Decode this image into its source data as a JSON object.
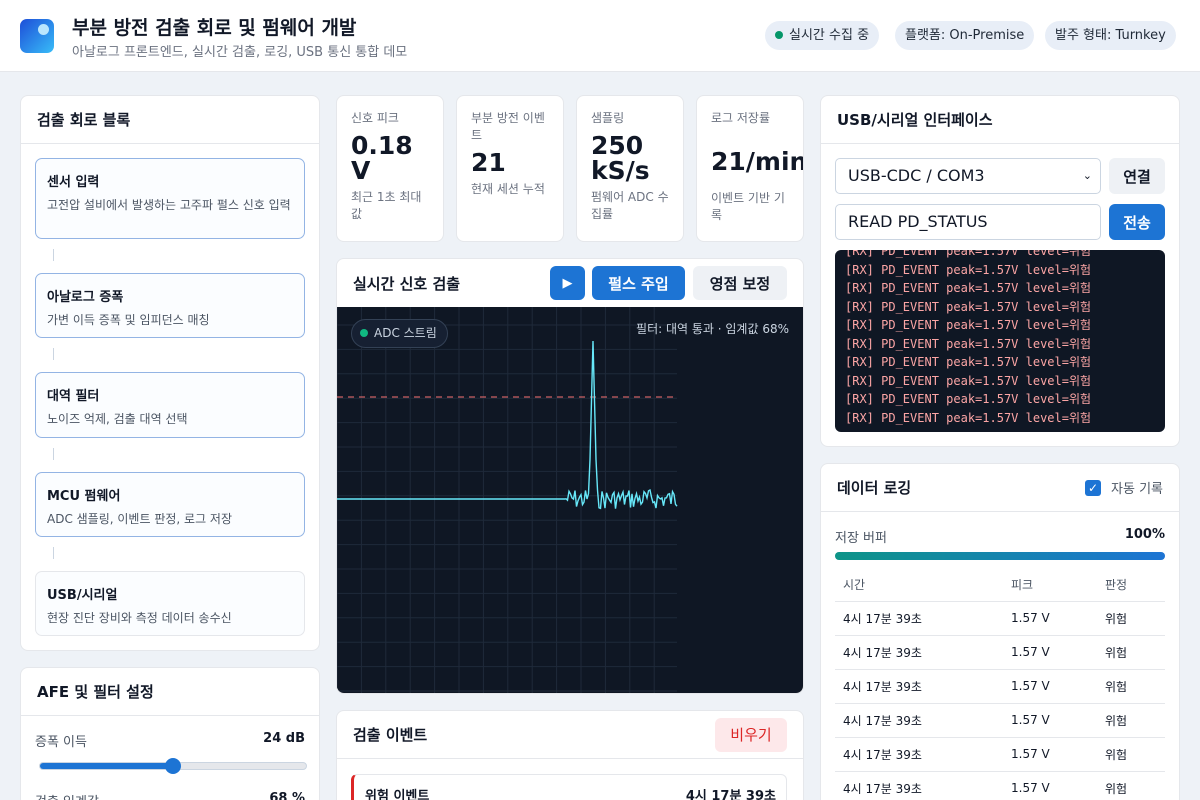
{
  "header": {
    "title": "부분 방전 검출 회로 및 펌웨어 개발",
    "subtitle": "아날로그 프론트엔드, 실시간 검출, 로깅, USB 통신 통합 데모",
    "pills": [
      "실시간 수집 중",
      "플랫폼: On-Premise",
      "발주 형태: Turnkey"
    ]
  },
  "blocks_card": {
    "title": "검출 회로 블록",
    "items": [
      {
        "title": "센서 입력",
        "desc": "고전압 설비에서 발생하는 고주파 펄스 신호 입력"
      },
      {
        "title": "아날로그 증폭",
        "desc": "가변 이득 증폭 및 임피던스 매칭"
      },
      {
        "title": "대역 필터",
        "desc": "노이즈 억제, 검출 대역 선택"
      },
      {
        "title": "MCU 펌웨어",
        "desc": "ADC 샘플링, 이벤트 판정, 로그 저장"
      },
      {
        "title": "USB/시리얼",
        "desc": "현장 진단 장비와 측정 데이터 송수신"
      }
    ]
  },
  "afe_card": {
    "title": "AFE 및 필터 설정",
    "gain_label": "증폭 이득",
    "gain_value": "24 dB",
    "gain_fraction": 0.5,
    "threshold_label": "검출 임계값",
    "threshold_value": "68 %"
  },
  "stats": [
    {
      "label": "신호 피크",
      "value": "0.18 V",
      "sub": "최근 1초 최대값"
    },
    {
      "label": "부분 방전 이벤트",
      "value": "21",
      "sub": "현재 세션 누적"
    },
    {
      "label": "샘플링",
      "value": "250 kS/s",
      "sub": "펌웨어 ADC 수집률"
    },
    {
      "label": "로그 저장률",
      "value": "21/min",
      "sub": "이벤트 기반 기록"
    }
  ],
  "signal_card": {
    "title": "실시간 신호 검출",
    "play_icon": "play-icon",
    "inject_label": "펄스 주입",
    "zero_label": "영점 보정",
    "stream_badge": "ADC 스트림",
    "filter_info": "필터: 대역 통과 · 임계값 68%"
  },
  "events_card": {
    "title": "검출 이벤트",
    "clear_label": "비우기",
    "events": [
      {
        "name": "위험 이벤트",
        "time": "4시 17분 39초"
      }
    ]
  },
  "usb_card": {
    "title": "USB/시리얼 인터페이스",
    "port_selected": "USB-CDC / COM3",
    "connect_label": "연결",
    "command_value": "READ PD_STATUS",
    "send_label": "전송",
    "console_lines": [
      "[RX] PD_EVENT peak=1.57V level=위험",
      "[RX] PD_EVENT peak=1.57V level=위험",
      "[RX] PD_EVENT peak=1.57V level=위험",
      "[RX] PD_EVENT peak=1.57V level=위험",
      "[RX] PD_EVENT peak=1.57V level=위험",
      "[RX] PD_EVENT peak=1.57V level=위험",
      "[RX] PD_EVENT peak=1.57V level=위험",
      "[RX] PD_EVENT peak=1.57V level=위험",
      "[RX] PD_EVENT peak=1.57V level=위험",
      "[RX] PD_EVENT peak=1.57V level=위험"
    ]
  },
  "logging_card": {
    "title": "데이터 로깅",
    "auto_label": "자동 기록",
    "auto_checked": true,
    "buffer_label": "저장 버퍼",
    "buffer_value": "100%",
    "buffer_fraction": 1.0,
    "columns": [
      "시간",
      "피크",
      "판정"
    ],
    "rows": [
      [
        "4시 17분 39초",
        "1.57 V",
        "위험"
      ],
      [
        "4시 17분 39초",
        "1.57 V",
        "위험"
      ],
      [
        "4시 17분 39초",
        "1.57 V",
        "위험"
      ],
      [
        "4시 17분 39초",
        "1.57 V",
        "위험"
      ],
      [
        "4시 17분 39초",
        "1.57 V",
        "위험"
      ],
      [
        "4시 17분 39초",
        "1.57 V",
        "위험"
      ]
    ]
  },
  "colors": {
    "accent": "#1d74d4",
    "danger": "#dc2626",
    "trace": "#67e8f9",
    "threshold_line": "#f87171",
    "plot_bg": "#0f1724"
  }
}
